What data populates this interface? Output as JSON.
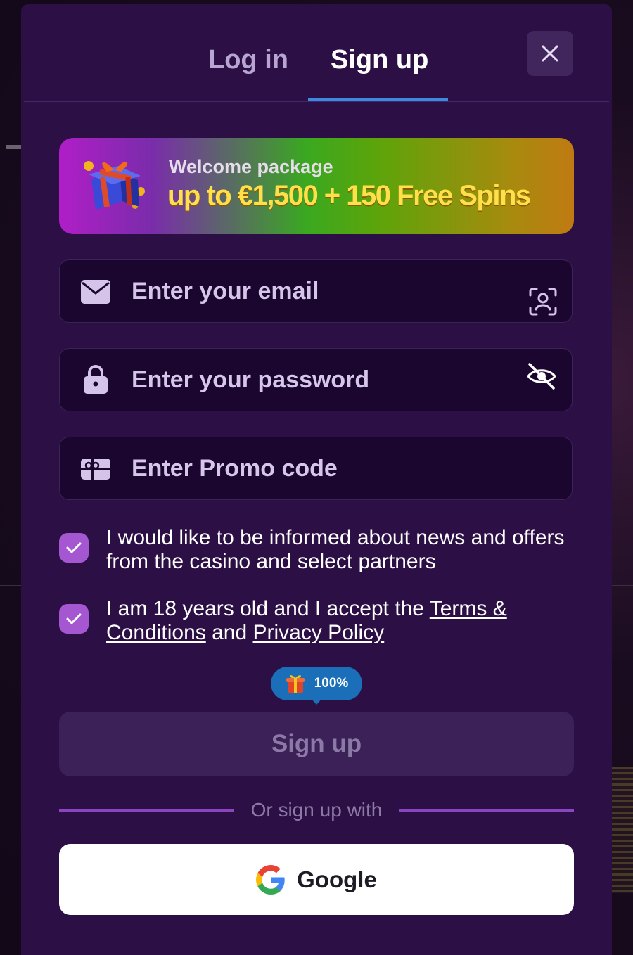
{
  "tabs": {
    "login": "Log in",
    "signup": "Sign up"
  },
  "promo": {
    "small": "Welcome package",
    "big": "up to €1,500 + 150 Free Spins"
  },
  "fields": {
    "email_placeholder": "Enter your email",
    "password_placeholder": "Enter your password",
    "promo_placeholder": "Enter Promo code"
  },
  "checks": {
    "news": "I would like to be informed about news and offers from the casino and select partners",
    "age_prefix": "I am 18 years old and I accept the ",
    "terms_link": "Terms & Conditions",
    "and": " and ",
    "privacy_link": "Privacy Policy"
  },
  "badge": {
    "text": "100%"
  },
  "signup_button": "Sign up",
  "divider_text": "Or sign up with",
  "google_button": "Google",
  "colors": {
    "modal_bg": "#2c0f44",
    "accent_blue": "#3b8be0",
    "checkbox": "#a457d0",
    "field_bg": "#1b0630"
  },
  "icons": {
    "close": "close-icon",
    "email": "envelope-icon",
    "face_id": "face-scan-icon",
    "lock": "lock-icon",
    "eye_off": "eye-off-icon",
    "promo": "gift-card-icon",
    "check": "checkmark-icon",
    "gift": "gift-icon",
    "google": "google-logo-icon"
  }
}
